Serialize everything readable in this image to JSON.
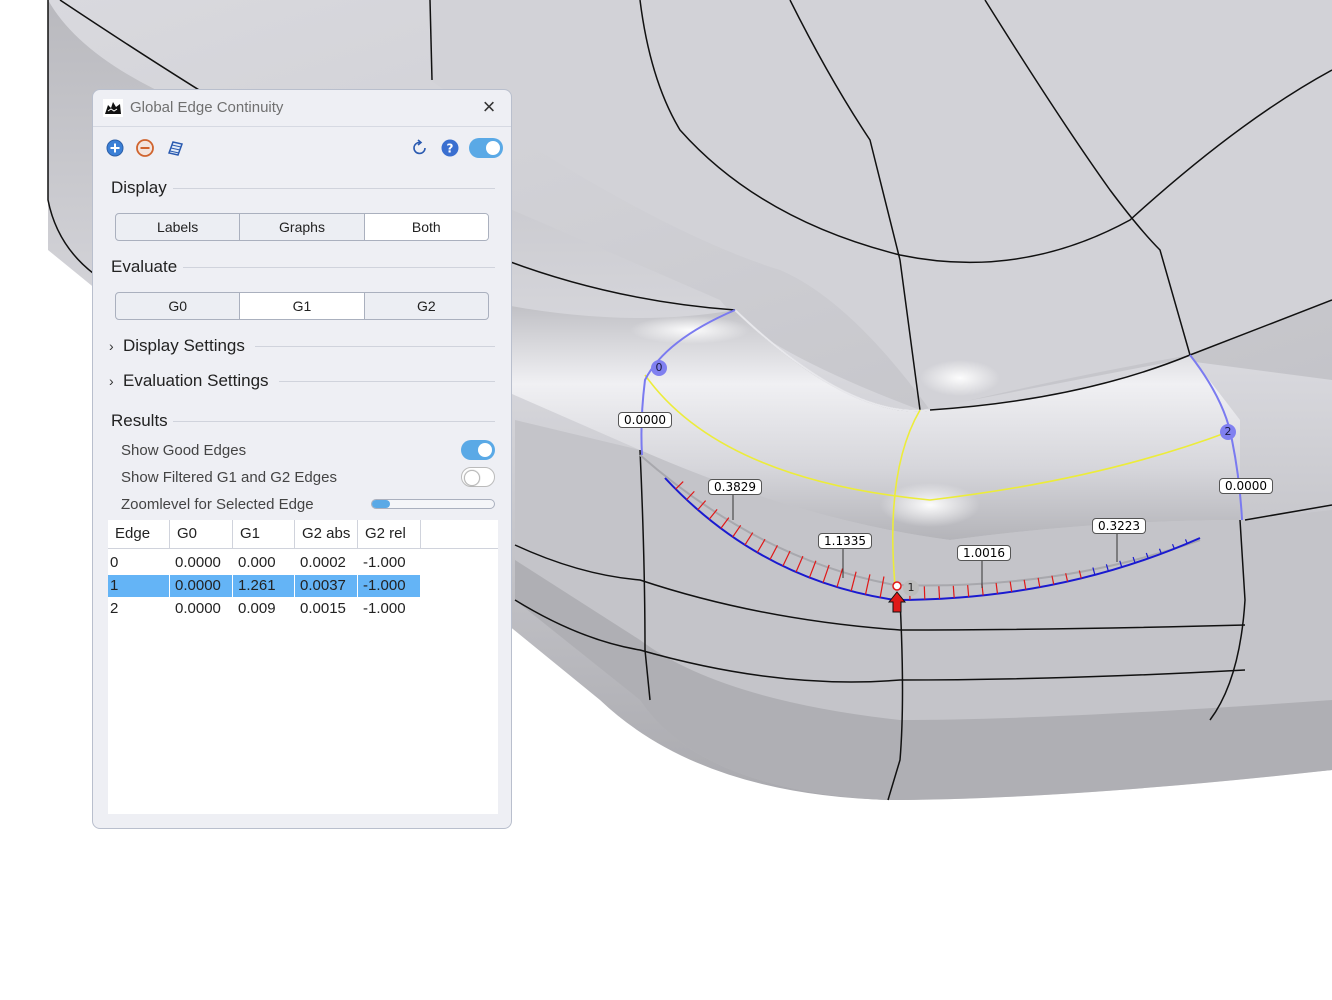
{
  "viewport": {
    "edge_badges": [
      "0",
      "1",
      "2"
    ],
    "value_labels": [
      "0.0000",
      "0.3829",
      "1.1335",
      "1.0016",
      "0.3223",
      "0.0000"
    ]
  },
  "panel": {
    "title": "Global Edge Continuity",
    "toolbar": {
      "add_icon": "plus-circle-icon",
      "remove_icon": "minus-circle-icon",
      "surface_icon": "surface-icon",
      "refresh_icon": "refresh-icon",
      "help_icon": "help-icon",
      "enabled": true
    },
    "display": {
      "heading": "Display",
      "options": [
        "Labels",
        "Graphs",
        "Both"
      ],
      "selected": "Both"
    },
    "evaluate": {
      "heading": "Evaluate",
      "options": [
        "G0",
        "G1",
        "G2"
      ],
      "selected": "G1"
    },
    "display_settings": "Display Settings",
    "evaluation_settings": "Evaluation Settings",
    "results": {
      "heading": "Results",
      "show_good_edges": {
        "label": "Show Good Edges",
        "on": true
      },
      "show_filtered": {
        "label": "Show Filtered G1 and G2 Edges",
        "on": false
      },
      "zoomlevel": {
        "label": "Zoomlevel for Selected Edge",
        "value": 0.15
      }
    },
    "table": {
      "columns": [
        "Edge",
        "G0",
        "G1",
        "G2 abs",
        "G2 rel"
      ],
      "rows": [
        [
          "0",
          "0.0000",
          "0.000",
          "0.0002",
          "-1.000"
        ],
        [
          "1",
          "0.0000",
          "1.261",
          "0.0037",
          "-1.000"
        ],
        [
          "2",
          "0.0000",
          "0.009",
          "0.0015",
          "-1.000"
        ]
      ],
      "selected_row": 1
    }
  },
  "colors": {
    "accent": "#5aa9e6",
    "selection": "#64b4f6",
    "edge_blue": "#7a7af0",
    "curvature_yellow": "#ecec3a",
    "comb_red": "#e01818",
    "comb_blue": "#1a1ad0"
  }
}
